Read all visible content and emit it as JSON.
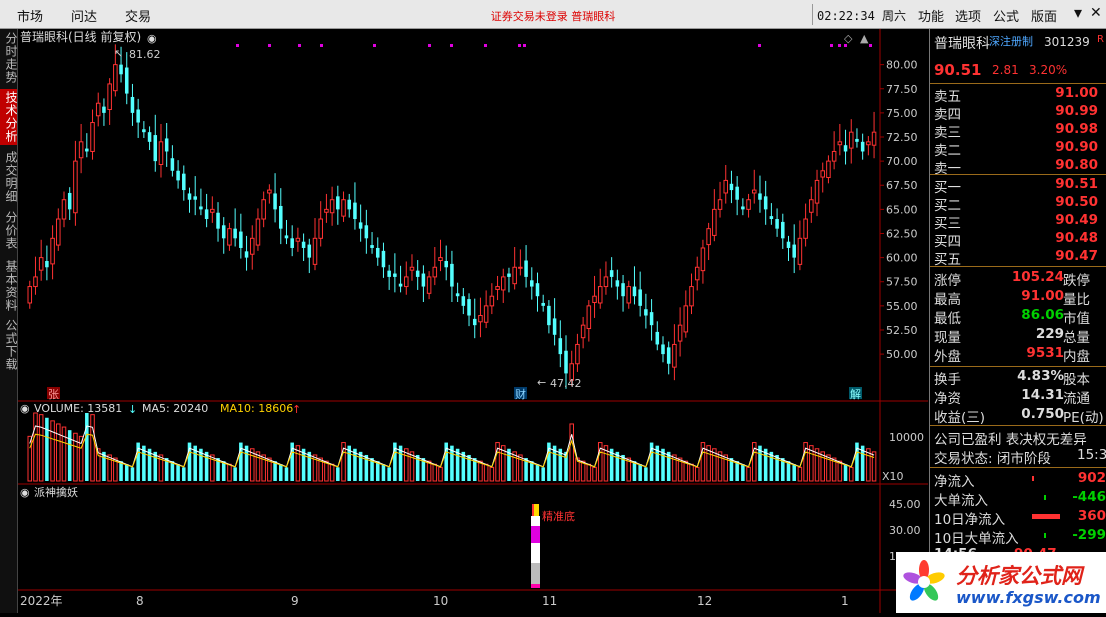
{
  "menu": {
    "items": [
      "市场",
      "问达",
      "交易"
    ],
    "notice": "证券交易未登录   普瑞眼科",
    "time": "02:22:34 周六",
    "right_items": [
      "功能",
      "选项",
      "公式",
      "版面"
    ],
    "icons": [
      "minimize-icon",
      "close-icon"
    ]
  },
  "left_tabs": [
    "分时走势",
    "技术分析",
    "成交明细",
    "分价表",
    "基本资料",
    "公式下载"
  ],
  "active_tab": 1,
  "stock_title": "普瑞眼科(日线 前复权)",
  "markers": {
    "high_label": "81.62",
    "low_label": "47.42",
    "zhang": "张",
    "cai": "财",
    "jie": "解"
  },
  "volume_header": {
    "vol": "VOLUME: 13581",
    "ma5": "MA5: 20240",
    "ma10": "MA10: 18606"
  },
  "indicator": {
    "name": "派神擒妖",
    "label": "精准底"
  },
  "axis_labels": {
    "x": [
      "2022年",
      "8",
      "9",
      "10",
      "11",
      "12",
      "1"
    ],
    "vol_max": "10000",
    "vol_unit": "X10",
    "ind": [
      "45.00",
      "30.00",
      "15.00"
    ]
  },
  "colors": {
    "up": "#ff3232",
    "down": "#54ffff",
    "ma5": "#ffffff",
    "ma10": "#ffd200"
  },
  "chart_data": {
    "type": "candlestick",
    "ylim": [
      47.42,
      81.62
    ],
    "price_ticks": [
      50,
      52.5,
      55,
      57.5,
      60,
      62.5,
      65,
      67.5,
      70,
      72.5,
      75,
      77.5,
      80
    ],
    "closes": [
      57,
      58,
      60,
      59,
      62,
      64,
      66,
      65,
      70,
      72,
      71,
      74,
      76,
      75,
      78,
      80,
      79,
      77,
      75,
      74,
      73,
      72,
      70,
      72,
      71,
      69,
      68,
      67,
      66,
      66,
      65,
      64,
      65,
      63,
      62,
      63,
      62,
      61,
      60,
      62,
      64,
      66,
      67,
      65,
      63,
      62,
      61,
      62,
      61,
      60,
      62,
      64,
      65,
      66,
      65,
      66,
      65,
      64,
      63,
      62,
      61,
      60,
      59,
      58,
      58,
      57,
      58,
      59,
      58,
      57,
      58,
      59,
      60,
      59,
      57,
      56,
      55,
      54,
      53,
      54,
      55,
      56,
      57,
      58,
      58,
      59,
      59,
      58,
      57,
      56,
      55,
      53,
      52,
      50,
      48,
      49,
      51,
      53,
      55,
      56,
      57,
      58,
      58,
      57,
      56,
      57,
      56,
      55,
      54,
      53,
      51,
      50,
      49,
      51,
      53,
      55,
      57,
      59,
      61,
      63,
      65,
      66,
      68,
      67,
      66,
      65,
      66,
      67,
      66,
      65,
      64,
      63,
      62,
      61,
      60,
      62,
      64,
      66,
      68,
      69,
      70,
      71,
      72,
      71,
      73,
      72,
      71,
      72,
      73
    ],
    "volume_max": 10000
  },
  "quote": {
    "name": "普瑞眼科",
    "tag": "深注册制",
    "code": "301239",
    "code_suffix": "R",
    "price": "90.51",
    "change": "2.81",
    "pct": "3.20%",
    "sells": [
      {
        "label": "卖五",
        "price": "91.00"
      },
      {
        "label": "卖四",
        "price": "90.99"
      },
      {
        "label": "卖三",
        "price": "90.98"
      },
      {
        "label": "卖二",
        "price": "90.90"
      },
      {
        "label": "卖一",
        "price": "90.80"
      }
    ],
    "buys": [
      {
        "label": "买一",
        "price": "90.51"
      },
      {
        "label": "买二",
        "price": "90.50"
      },
      {
        "label": "买三",
        "price": "90.49"
      },
      {
        "label": "买四",
        "price": "90.48"
      },
      {
        "label": "买五",
        "price": "90.47"
      }
    ],
    "stats": [
      {
        "l": "涨停",
        "v": "105.24",
        "r": "跌停",
        "c": "red"
      },
      {
        "l": "最高",
        "v": "91.00",
        "r": "量比",
        "c": "red"
      },
      {
        "l": "最低",
        "v": "86.06",
        "r": "市值",
        "c": "green"
      },
      {
        "l": "现量",
        "v": "229",
        "r": "总量",
        "c": "white"
      },
      {
        "l": "外盘",
        "v": "9531",
        "r": "内盘",
        "c": "red"
      }
    ],
    "stats2": [
      {
        "l": "换手",
        "v": "4.83%",
        "r": "股本"
      },
      {
        "l": "净资",
        "v": "14.31",
        "r": "流通"
      },
      {
        "l": "收益(三)",
        "v": "0.750",
        "r": "PE(动)"
      }
    ],
    "info1": "公司已盈利 表决权无差异",
    "info2": "交易状态: 闭市阶段",
    "info2_time": "15:3",
    "flows": [
      {
        "l": "净流入",
        "v": "902",
        "c": "red"
      },
      {
        "l": "大单流入",
        "v": "-446",
        "c": "green"
      },
      {
        "l": "10日净流入",
        "v": "360",
        "c": "red"
      },
      {
        "l": "10日大单流入",
        "v": "-299",
        "c": "green"
      }
    ],
    "last_tick": {
      "time": "14:56",
      "price": "90.47"
    }
  },
  "watermark": {
    "text": "分析家公式网",
    "url": "www.fxgsw.com"
  }
}
